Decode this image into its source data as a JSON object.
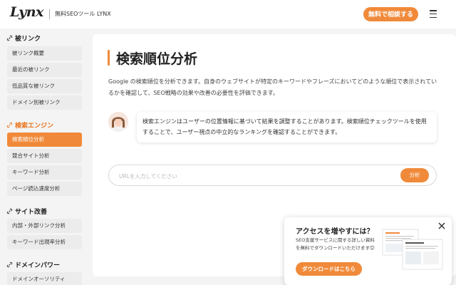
{
  "header": {
    "logo": "Lynx",
    "tagline": "無料SEOツール LYNX",
    "consult_button": "無料で相談する",
    "menu_icon": "hamburger-icon"
  },
  "sidebar": {
    "sections": [
      {
        "title": "被リンク",
        "icon": "link-icon",
        "items": [
          "被リンク概要",
          "最近の被リンク",
          "低品質な被リンク",
          "ドメイン別被リンク"
        ]
      },
      {
        "title": "検索エンジン",
        "icon": "link-icon",
        "items": [
          "検索順位分析",
          "競合サイト分析",
          "キーワード分析",
          "ページ読込速度分析"
        ]
      },
      {
        "title": "サイト改善",
        "icon": "link-icon",
        "items": [
          "内部・外部リンク分析",
          "キーワード出現率分析"
        ]
      },
      {
        "title": "ドメインパワー",
        "icon": "link-icon",
        "items": [
          "ドメインオーソリティ"
        ]
      }
    ],
    "active_section": "検索エンジン",
    "selected_item": "検索順位分析"
  },
  "main": {
    "title": "検索順位分析",
    "description": "Google の検索順位を分析できます。自身のウェブサイトが特定のキーワードやフレーズにおいてどのような順位で表示されているかを確認して、SEO戦略の効果や改善の必要性を評価できます。",
    "assistant_message": "検索エンジンはユーザーの位置情報に基づいて結果を調整することがあります。検索順位チェックツールを使用することで、ユーザー視点の中立的なランキングを確認することができます。",
    "url_input": {
      "value": "",
      "placeholder": "URLを入力してください"
    },
    "analyze_button": "分析"
  },
  "popup": {
    "title": "アクセスを増やすには？",
    "text": "SEO支援サービスに関する詳しい資料を無料でダウンロードいただけます😊",
    "download_button": "ダウンロードはこちら",
    "close_icon": "close-icon"
  },
  "colors": {
    "accent": "#f08a3a",
    "background": "#f4f4f4",
    "panel": "#ffffff"
  }
}
